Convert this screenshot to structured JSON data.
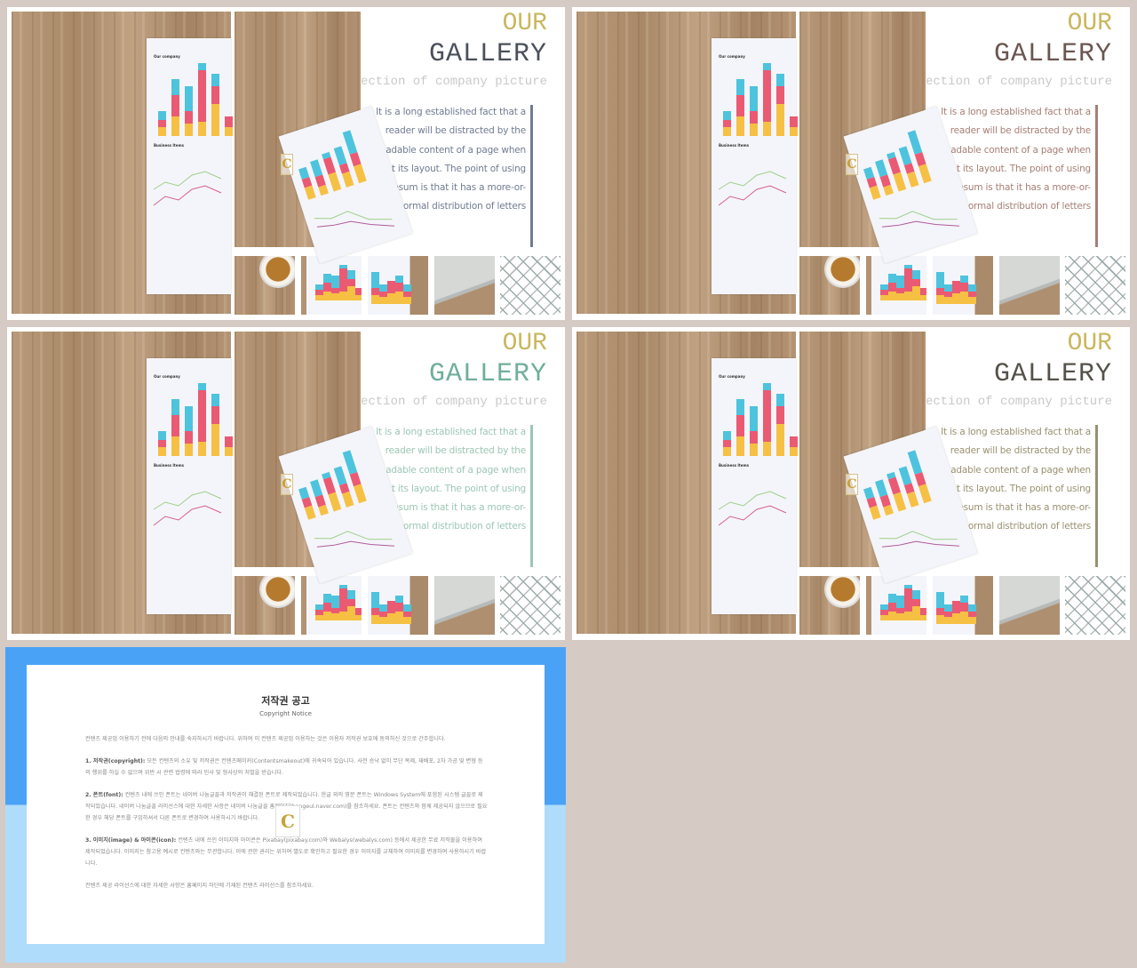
{
  "slides": [
    {
      "our": "OUR",
      "gallery": "GALLERY",
      "subtitle": "collection of company picture",
      "body": "It is a long established fact that a reader will be distracted by the readable content of a page when looking at its layout. The point of using Lorem Ipsum is that it has a more-or-less normal distribution of letters",
      "accent": "#6f7c91",
      "gallery_color": "#4b505c"
    },
    {
      "our": "OUR",
      "gallery": "GALLERY",
      "subtitle": "collection of company picture",
      "body": "It is a long established fact that a reader will be distracted by the readable content of a page when looking at its layout. The point of using Lorem Ipsum is that it has a more-or-less normal distribution of letters",
      "accent": "#a57f74",
      "gallery_color": "#6b5650"
    },
    {
      "our": "OUR",
      "gallery": "GALLERY",
      "subtitle": "collection of company picture",
      "body": "It is a long established fact that a reader will be distracted by the readable content of a page when looking at its layout. The point of using Lorem Ipsum is that it has a more-or-less normal distribution of letters",
      "accent": "#9cc6b5",
      "gallery_color": "#6fae9b"
    },
    {
      "our": "OUR",
      "gallery": "GALLERY",
      "subtitle": "collection of company picture",
      "body": "It is a long established fact that a reader will be distracted by the readable content of a page when looking at its layout. The point of using Lorem Ipsum is that it has a more-or-less normal distribution of letters",
      "accent": "#9a9070",
      "gallery_color": "#55524a"
    }
  ],
  "photo_text": {
    "chart_title": "Our company",
    "section": "Business Items"
  },
  "watermark": "C",
  "copyright": {
    "title": "저작권 공고",
    "subtitle": "Copyright Notice",
    "intro": "컨텐츠 제공업 이용하기 전에 다음의 안내를 숙지하시기 바랍니다. 위하여 이 컨텐츠 제공업 이용하는 것은 이용자 저작권 보호에 동의하신 것으로 간주합니다.",
    "s1_head": "1. 저작권(copyright):",
    "s1": "모든 컨텐츠의 소유 및 저작권은 컨텐츠메이커(Contentsmakeout)에 귀속되어 있습니다. 사전 승낙 없이 무단 복제, 재배포, 2차 가공 및 변형 등의 행위를 하실 수 없으며 위반 시 관련 법령에 따라 민사 및 형사상의 처벌을 받습니다.",
    "s2_head": "2. 폰트(font):",
    "s2": "컨텐츠 내에 쓰인 폰트는 네이버 나눔글꼴과 저작권이 해결된 폰트로 제작되었습니다. 한글 외의 영문 폰트는 Windows System에 포함된 시스템 글꼴로 제작되었습니다. 네이버 나눔글꼴 라이선스에 대한 자세한 사항은 네이버 나눔글꼴 홈페이지(hangeul.naver.com)를 참조하세요. 폰트는 컨텐츠와 함께 제공되지 않으므로 필요한 경우 해당 폰트를 구입하셔서 다른 폰트로 변경하여 사용하시기 바랍니다.",
    "s3_head": "3. 이미지(image) & 아이콘(icon):",
    "s3": "컨텐츠 내에 쓰인 이미지와 아이콘은 Pixabay(pixabay.com)와 Webalys(webalys.com) 등에서 제공한 무료 저작물을 이용하여 제작되었습니다. 이미지는 참고용 예시로 컨텐츠와는 무관합니다. 이에 관한 권리는 위하여 별도로 확인하고 필요한 경우 이미지를 교체하여 이미지를 변경하여 사용하시기 바랍니다.",
    "outro": "컨텐츠 제공 라이선스에 대한 자세한 사항은 홈페이지 하단에 기재된 컨텐츠 라이선스를 참조하세요."
  }
}
